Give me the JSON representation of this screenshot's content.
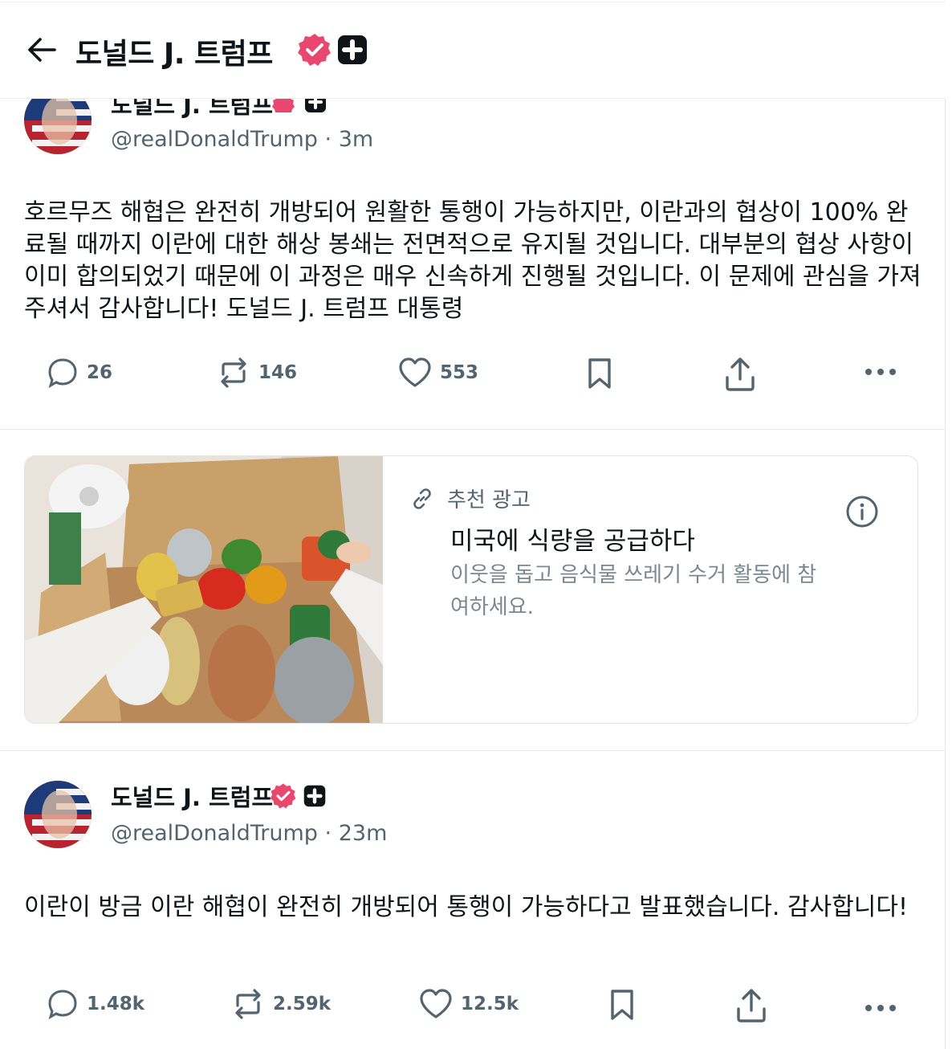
{
  "header": {
    "title": "도널드 J. 트럼프"
  },
  "posts": [
    {
      "name": "도널드 J. 트럼프",
      "handle": "@realDonaldTrump",
      "time": "3m",
      "text": "호르무즈 해협은 완전히 개방되어 원활한 통행이 가능하지만, 이란과의 협상이 100% 완료될 때까지 이란에 대한 해상 봉쇄는 전면적으로 유지될 것입니다. 대부분의 협상 사항이 이미 합의되었기 때문에 이 과정은 매우 신속하게 진행될 것입니다. 이 문제에 관심을 가져주셔서 감사합니다! 도널드 J. 트럼프 대통령",
      "replies": "26",
      "reposts": "146",
      "likes": "553"
    },
    {
      "name": "도널드 J. 트럼프",
      "handle": "@realDonaldTrump",
      "time": "23m",
      "text": "이란이 방금 이란 해협이 완전히 개방되어 통행이 가능하다고 발표했습니다. 감사합니다!",
      "replies": "1.48k",
      "reposts": "2.59k",
      "likes": "12.5k"
    }
  ],
  "ad": {
    "label": "추천 광고",
    "title": "미국에 식량을 공급하다",
    "description": "이웃을 돕고 음식물 쓰레기 수거 활동에 참여하세요."
  },
  "icons": {
    "back": "arrow-left-icon",
    "verified": "verified-badge-icon",
    "plus": "plus-badge-icon",
    "reply": "reply-icon",
    "repost": "repost-icon",
    "like": "heart-icon",
    "bookmark": "bookmark-icon",
    "share": "share-icon",
    "more": "more-icon",
    "link": "link-icon",
    "info": "info-icon"
  },
  "colors": {
    "verified": "#e8486f",
    "text": "#0f1419",
    "muted": "#536471"
  }
}
